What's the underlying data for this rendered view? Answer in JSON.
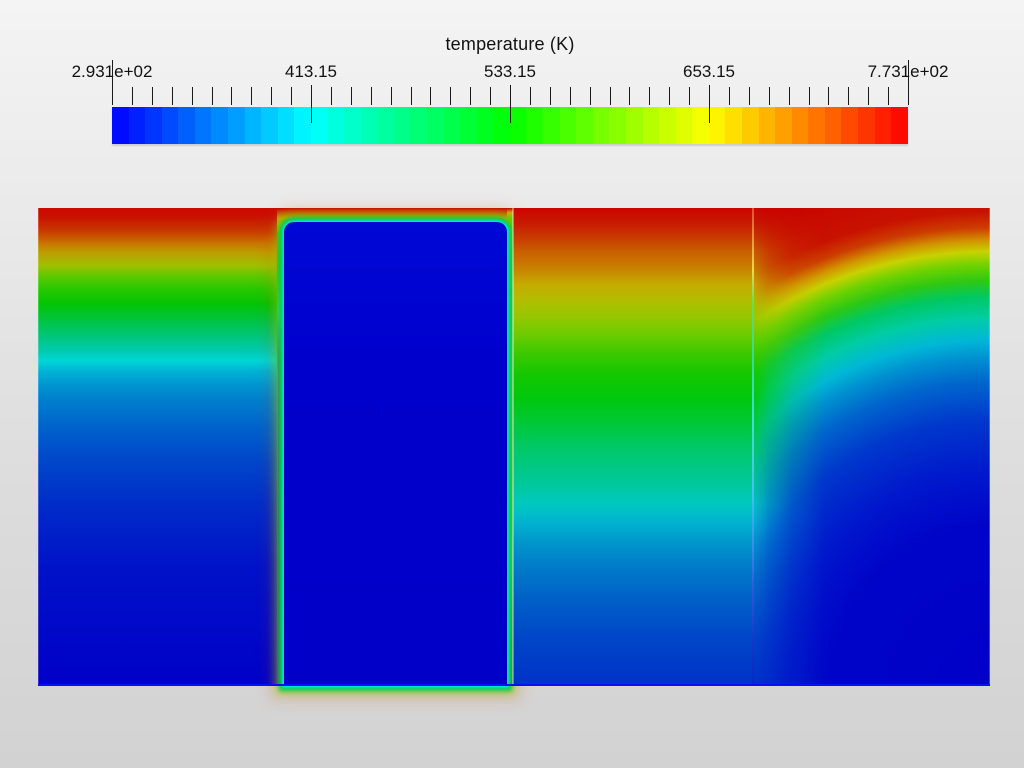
{
  "view": {
    "app_context": "scientific visualization render view",
    "background_top": "#f4f4f4",
    "background_bottom": "#d2d2d2"
  },
  "colorbar": {
    "title": "temperature (K)",
    "labels": [
      {
        "text": "2.931e+02",
        "frac": 0.0
      },
      {
        "text": "413.15",
        "frac": 0.25
      },
      {
        "text": "533.15",
        "frac": 0.5
      },
      {
        "text": "653.15",
        "frac": 0.75
      },
      {
        "text": "7.731e+02",
        "frac": 1.0
      }
    ],
    "ticks": {
      "count": 41,
      "end_indices": [
        0,
        40
      ],
      "mid_major_indices": [
        10,
        20,
        30
      ]
    },
    "bands": {
      "count": 48,
      "hue_start": 240,
      "hue_end": 0,
      "saturation": 100,
      "lightness": 50
    }
  },
  "chart_data": {
    "type": "heatmap",
    "title": "temperature (K)",
    "units": "K",
    "scale": {
      "min": 293.1,
      "max": 773.1,
      "tick_values": [
        293.1,
        413.15,
        533.15,
        653.15,
        773.1
      ],
      "tick_labels": [
        "2.931e+02",
        "413.15",
        "533.15",
        "653.15",
        "7.731e+02"
      ],
      "colormap": "blue-to-red rainbow (jet)",
      "discrete_bands": 48,
      "legend_position": "top horizontal"
    },
    "field": {
      "description": "2D temperature field, hot (~773 K) top boundary, cold (~293 K) deep regions and inner block",
      "regions": [
        {
          "name": "left-solid",
          "pattern": "vertical gradient red>yellow>green>cyan>blue, blue below ~45% depth"
        },
        {
          "name": "cold-block",
          "pattern": "uniform ~293 K rounded-top block with thin cyan/green heated boundary layer, red skin above"
        },
        {
          "name": "heated-strip",
          "pattern": "thin hot vertical layer on block right edge, green fading to blue with depth"
        },
        {
          "name": "middle-solid",
          "pattern": "vertical gradient, warmer than left region, green until ~45% depth"
        },
        {
          "name": "right-solid",
          "pattern": "radial pattern, cold dark-blue core at bottom-right, red top edge, warm along left seam"
        }
      ]
    }
  },
  "field": {
    "gradients": {
      "panelA": "linear-gradient(180deg,#cc0800 0%,#c81400 2%,#c83c00 5%,#c87800 7.5%,#bca000 9.5%,#a0c000 12%,#64c800 14%,#28c800 17%,#04c404 20%,#00c44a 24%,#00c67e 27%,#00cbb2 30%,#00d6d6 32%,#00b4d4 34%,#0096d0 37%,#0080cc 40%,#0062cc 46%,#0046ca 53%,#002cc8 62%,#0012c8 75%,#0000c8 100%)",
      "panelB": "linear-gradient(180deg,#c80000 0%,#c85000 1%,#bea600 2.1%,#8cc800 3.3%,#28c800 5.4%,#00c846 13.8%,#00c9a0 18%,#00ccd6 22.2%,#0094cc 26.4%,#0068cc 30.5%,#0030c8 44%,#000ac8 67%,#0000c8 100%)",
      "block": "linear-gradient(180deg,#0008d6 0%,#0000cc 30%,#0000c8 100%)",
      "strip": "linear-gradient(180deg,#c80000 0%,#d2b400 1%,#5ad200 2.2%,#0ed02c 10%,#00cd46 55%,#00c896 67%,#00c2c2 73.5%,#00a0cc 78%,#0080cc 82%,#0048c8 90%,#0028c8 100%)",
      "panelC": "linear-gradient(180deg,#cc0400 0%,#c81800 3%,#c83800 6%,#c85e00 9%,#c88000 12.5%,#c4ac00 16%,#b4bc00 19%,#94c800 23%,#66cc00 27%,#36c800 31%,#12c800 35%,#00c80e 40%,#00c838 45%,#00c85e 49%,#00c882 54%,#00c89e 58%,#00c8c0 62%,#00b2d0 66%,#0096cc 70%,#007cc8 75%,#0060c8 82%,#0046c8 90%,#0032c8 100%)",
      "panelD": "radial-gradient(circle 533px at 100% 100%,#0000c8 0%,#0004c8 30%,#0018cc 40%,#0038cc 50%,#0066cc 57%,#0090d0 61.5%,#00b8d6 65%,#00cca6 69%,#00c862 73%,#2ec814 76%,#70d200 79%,#c8d200 81.5%,#d29600 83.5%,#cc3c00 86%,#c81200 89%,#c80000 100%)",
      "pdBlend": "linear-gradient(180deg,#cc0400 0%,#c81800 3%,#c83800 6%,#c85e00 9%,#c88000 12.5%,#c4ac00 16%,#b4bc00 19%,#94c800 23%,#66cc00 27%,#36c800 31%,#12c800 35%,#00c80e 40%,#00c838 45%,#00c85e 49%,#00c882 54%,#00c89e 58%,#00c8c0 62%,#00b2d0 66%,#0096cc 70%,#007cc8 75%,#0060c8 82%,#0046c8 90%,#0032c8 100%)",
      "seamAB": "linear-gradient(180deg,rgba(255,255,255,0) 0%,rgba(255,255,255,0) 26%,rgba(130,170,255,0.35) 34%,rgba(90,120,255,0.42) 60%,rgba(70,90,255,0.38) 100%)",
      "seamCD": "linear-gradient(180deg,#e05030 0%,#e8a83c 8%,#ecd94e 13%,#62e056 20%,#36dc96 32%,#3ee0d6 45%,#40c2ea 60%,#3886e8 72%,#2f56d8 80%,rgba(30,50,200,0.55) 90%,rgba(10,20,190,0.35) 100%)",
      "bottomEdge": "#0510fa"
    },
    "block_glow": "0 0 2px 2px #00e2de, 0 0 5px 5px #00cc42, 0 0 9px 9px rgba(160,212,0,0.45), 0 0 16px 14px rgba(210,80,0,0.18)"
  }
}
